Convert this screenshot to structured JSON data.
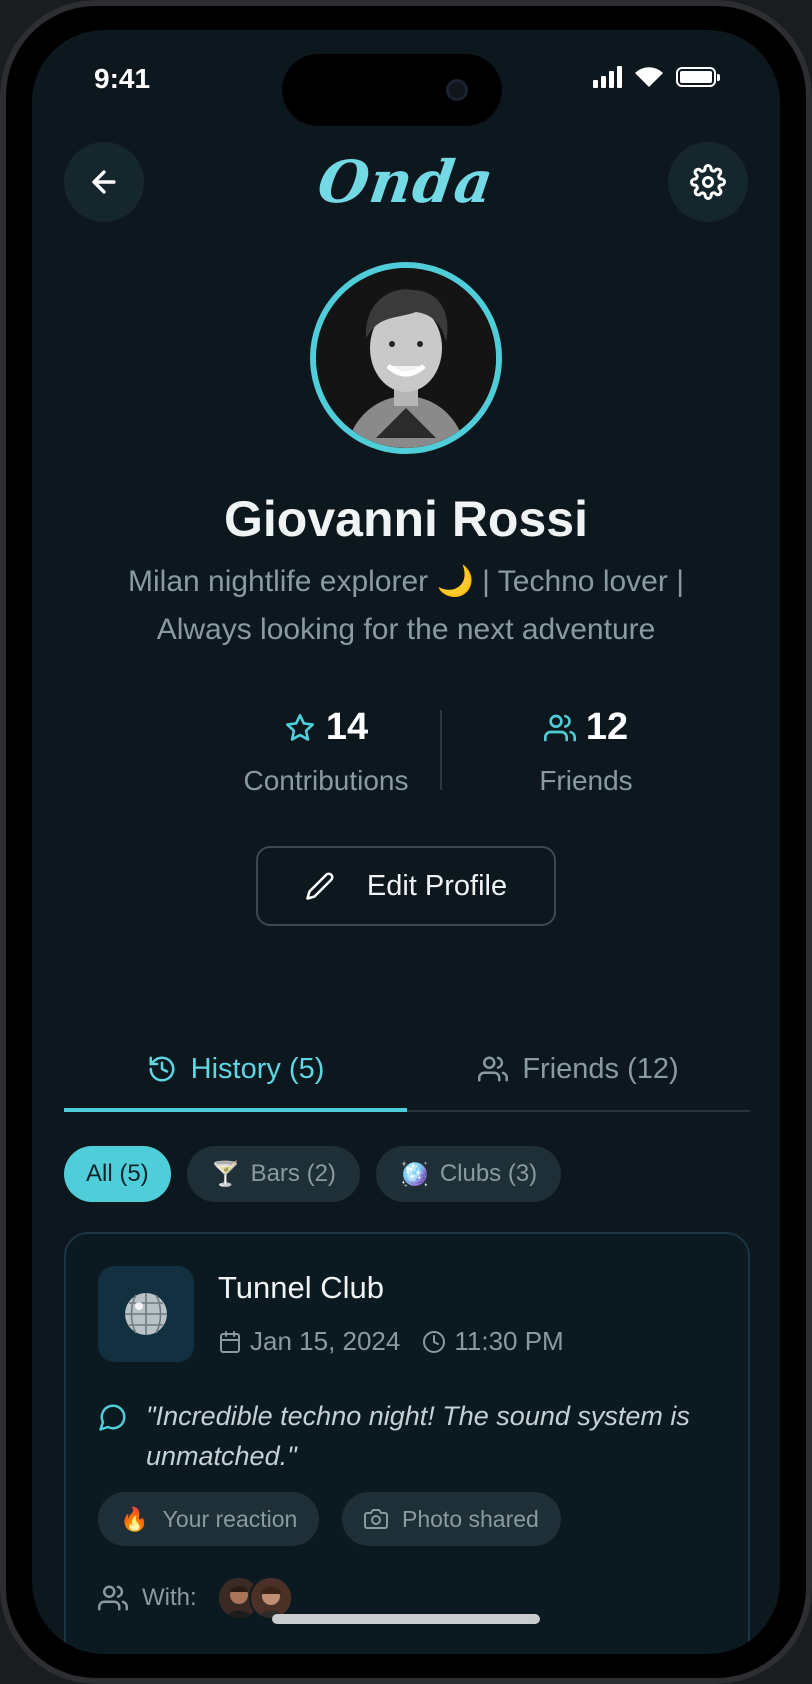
{
  "status_bar": {
    "time": "9:41"
  },
  "header": {
    "logo": "Onda"
  },
  "profile": {
    "name": "Giovanni Rossi",
    "bio_line1": "Milan nightlife explorer 🌙  | Techno lover |",
    "bio_line2": "Always looking for the next adventure"
  },
  "stats": {
    "contributions": {
      "value": "14",
      "label": "Contributions"
    },
    "friends": {
      "value": "12",
      "label": "Friends"
    }
  },
  "edit_button": {
    "label": "Edit Profile"
  },
  "tabs": [
    {
      "label": "History (5)",
      "active": true
    },
    {
      "label": "Friends (12)",
      "active": false
    }
  ],
  "filters": [
    {
      "label": "All (5)",
      "emoji": "",
      "active": true
    },
    {
      "label": "Bars (2)",
      "emoji": "🍸",
      "active": false
    },
    {
      "label": "Clubs (3)",
      "emoji": "🪩",
      "active": false
    }
  ],
  "history_card": {
    "venue": "Tunnel Club",
    "date": "Jan 15, 2024",
    "time": "11:30 PM",
    "quote": "\"Incredible techno night! The sound system is unmatched.\"",
    "reaction_emoji": "🔥",
    "reaction_label": "Your reaction",
    "photo_label": "Photo shared",
    "with_label": "With:"
  },
  "colors": {
    "accent": "#4fcdd9",
    "background": "#0c181e",
    "card": "#0b1920"
  }
}
